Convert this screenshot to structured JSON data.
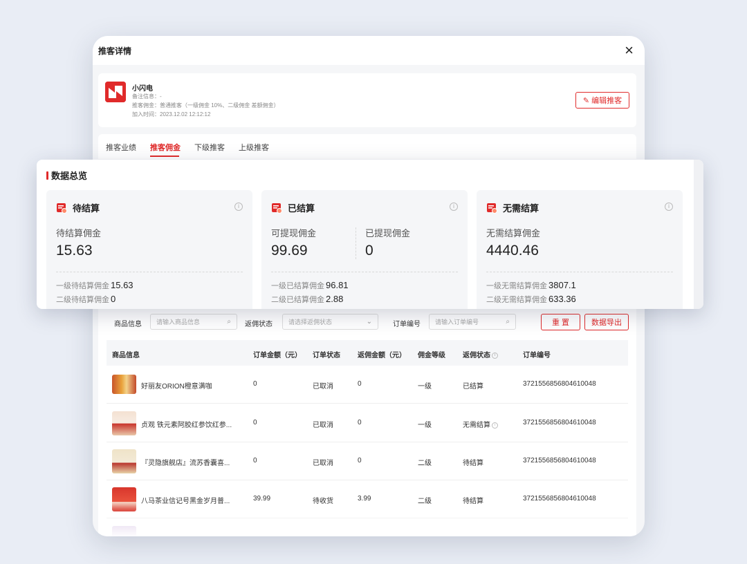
{
  "modal": {
    "title": "推客详情",
    "close": "×"
  },
  "profile": {
    "name": "小闪电",
    "note": "备注信息：-",
    "commission": "推客佣金：普通推客（一级佣金 10%、二级佣金 差额佣金）",
    "joined": "加入时间：2023.12.02 12:12:12",
    "edit_label": "编辑推客"
  },
  "tabs": [
    "推客业绩",
    "推客佣金",
    "下级推客",
    "上级推客"
  ],
  "overview": {
    "title": "数据总览",
    "cards": [
      {
        "title": "待结算",
        "labels": [
          "待结算佣金"
        ],
        "values": [
          "15.63"
        ],
        "rows": [
          {
            "label": "一级待结算佣金",
            "value": "15.63"
          },
          {
            "label": "二级待结算佣金",
            "value": "0"
          }
        ]
      },
      {
        "title": "已结算",
        "labels": [
          "可提现佣金",
          "已提现佣金"
        ],
        "values": [
          "99.69",
          "0"
        ],
        "rows": [
          {
            "label": "一级已结算佣金",
            "value": "96.81"
          },
          {
            "label": "二级已结算佣金",
            "value": "2.88"
          }
        ]
      },
      {
        "title": "无需结算",
        "labels": [
          "无需结算佣金"
        ],
        "values": [
          "4440.46"
        ],
        "rows": [
          {
            "label": "一级无需结算佣金",
            "value": "3807.1"
          },
          {
            "label": "二级无需结算佣金",
            "value": "633.36"
          }
        ]
      }
    ]
  },
  "filters": {
    "product_label": "商品信息",
    "product_placeholder": "请输入商品信息",
    "status_label": "返佣状态",
    "status_placeholder": "请选择返佣状态",
    "order_label": "订单编号",
    "order_placeholder": "请输入订单编号",
    "reset_label": "重 置",
    "export_label": "数据导出"
  },
  "table": {
    "headers": [
      "商品信息",
      "订单金额（元）",
      "订单状态",
      "返佣金额（元）",
      "佣金等级",
      "返佣状态",
      "订单编号"
    ],
    "rows": [
      {
        "name": "好丽友ORION橙意满咖",
        "amount": "0",
        "status": "已取消",
        "rebate": "0",
        "level": "一级",
        "rebate_status": "已结算",
        "order_no": "3721556856804610048"
      },
      {
        "name": "贞观 铁元素阿胶红参饮红参...",
        "amount": "0",
        "status": "已取消",
        "rebate": "0",
        "level": "一级",
        "rebate_status": "无需结算",
        "order_no": "3721556856804610048"
      },
      {
        "name": "『灵隐旗舰店』流苏香囊喜...",
        "amount": "0",
        "status": "已取消",
        "rebate": "0",
        "level": "二级",
        "rebate_status": "待结算",
        "order_no": "3721556856804610048"
      },
      {
        "name": "八马茶业信记号黑金岁月普...",
        "amount": "39.99",
        "status": "待收货",
        "rebate": "3.99",
        "level": "二级",
        "rebate_status": "待结算",
        "order_no": "3721556856804610048"
      }
    ]
  },
  "colors": {
    "accent": "#e02a2a",
    "background": "#e9edf5",
    "card": "#f5f6f8"
  }
}
